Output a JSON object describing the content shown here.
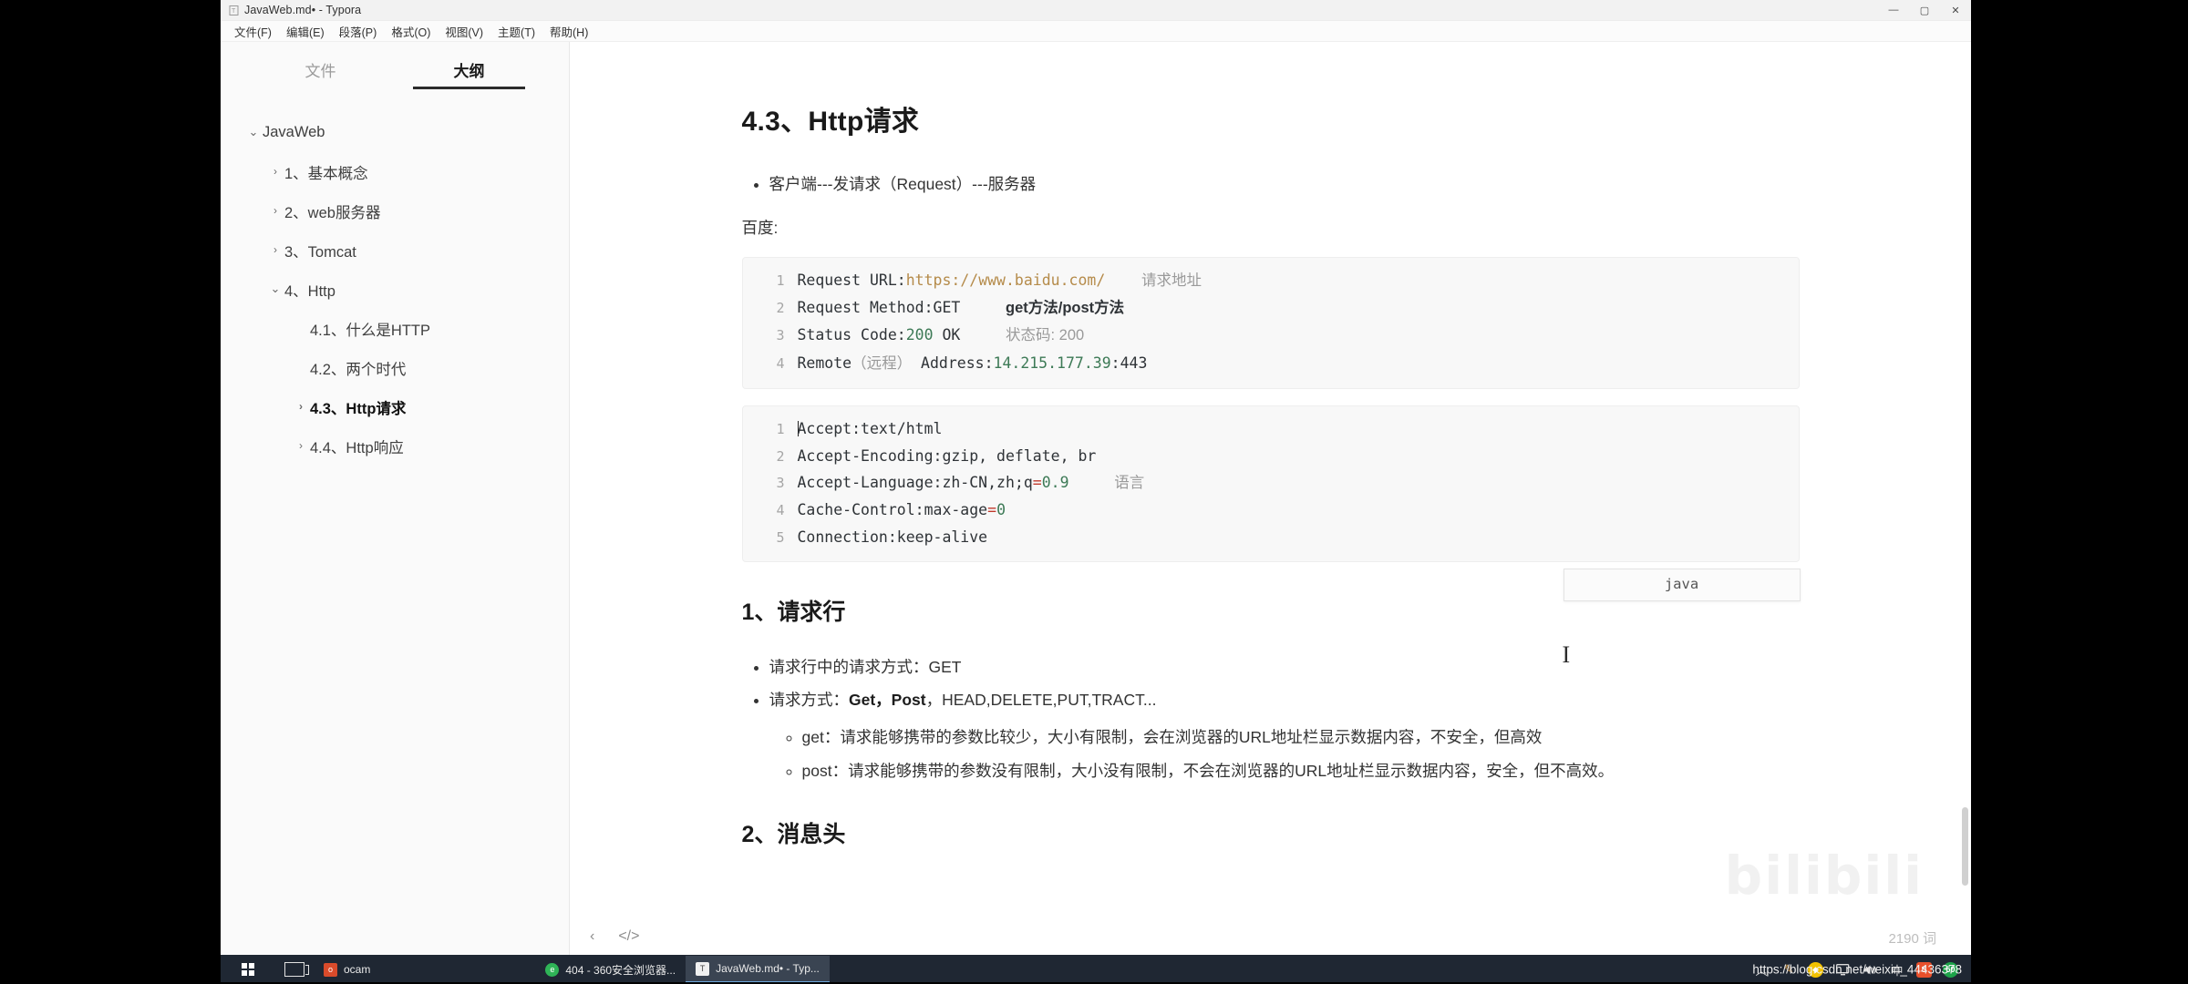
{
  "window": {
    "title": "JavaWeb.md• - Typora",
    "doc_icon": "document-icon",
    "controls": {
      "minimize": "—",
      "maximize": "▢",
      "close": "✕"
    }
  },
  "menubar": {
    "items": [
      "文件(F)",
      "编辑(E)",
      "段落(P)",
      "格式(O)",
      "视图(V)",
      "主题(T)",
      "帮助(H)"
    ]
  },
  "sidebar": {
    "tabs": [
      {
        "label": "文件",
        "active": false
      },
      {
        "label": "大纲",
        "active": true
      }
    ],
    "outline": [
      {
        "label": "JavaWeb",
        "level": 0,
        "caret": "down",
        "active": false
      },
      {
        "label": "1、基本概念",
        "level": 1,
        "caret": "right",
        "active": false
      },
      {
        "label": "2、web服务器",
        "level": 1,
        "caret": "right",
        "active": false
      },
      {
        "label": "3、Tomcat",
        "level": 1,
        "caret": "right",
        "active": false
      },
      {
        "label": "4、Http",
        "level": 1,
        "caret": "down",
        "active": false
      },
      {
        "label": "4.1、什么是HTTP",
        "level": 2,
        "caret": "none",
        "active": false
      },
      {
        "label": "4.2、两个时代",
        "level": 2,
        "caret": "none",
        "active": false
      },
      {
        "label": "4.3、Http请求",
        "level": 2,
        "caret": "right",
        "active": true
      },
      {
        "label": "4.4、Http响应",
        "level": 2,
        "caret": "right",
        "active": false
      }
    ]
  },
  "document": {
    "heading": "4.3、Http请求",
    "bullet_1": "客户端---发请求（Request）---服务器",
    "paragraph_baidu": "百度:",
    "code_block_1": {
      "lines": [
        {
          "n": "1",
          "segments": [
            {
              "t": "Request URL:",
              "c": "plain"
            },
            {
              "t": "https://www.baidu.com/",
              "c": "url"
            },
            {
              "t": "    ",
              "c": "plain"
            },
            {
              "t": "请求地址",
              "c": "comment-cn"
            }
          ]
        },
        {
          "n": "2",
          "segments": [
            {
              "t": "Request Method:GET",
              "c": "plain"
            },
            {
              "t": "     ",
              "c": "plain"
            },
            {
              "t": "get方法/post方法",
              "c": "comment-cn-bold"
            }
          ]
        },
        {
          "n": "3",
          "segments": [
            {
              "t": "Status Code:",
              "c": "plain"
            },
            {
              "t": "200",
              "c": "num"
            },
            {
              "t": " OK",
              "c": "plain"
            },
            {
              "t": "     ",
              "c": "plain"
            },
            {
              "t": "状态码: 200",
              "c": "comment-cn"
            }
          ]
        },
        {
          "n": "4",
          "segments": [
            {
              "t": "Remote",
              "c": "plain"
            },
            {
              "t": "（远程）",
              "c": "comment-cn"
            },
            {
              "t": " Address:",
              "c": "plain"
            },
            {
              "t": "14.215.177.39",
              "c": "num"
            },
            {
              "t": ":443",
              "c": "plain"
            }
          ]
        }
      ]
    },
    "code_block_2": {
      "language_label": "java",
      "lines": [
        {
          "n": "1",
          "segments": [
            {
              "t": "Accept:text/html",
              "c": "plain"
            }
          ]
        },
        {
          "n": "2",
          "segments": [
            {
              "t": "Accept-Encoding:gzip, deflate, br",
              "c": "plain"
            }
          ]
        },
        {
          "n": "3",
          "segments": [
            {
              "t": "Accept-Language:zh-CN,zh;q",
              "c": "plain"
            },
            {
              "t": "=",
              "c": "op"
            },
            {
              "t": "0.9",
              "c": "num"
            },
            {
              "t": "     ",
              "c": "plain"
            },
            {
              "t": "语言",
              "c": "comment-cn"
            }
          ]
        },
        {
          "n": "4",
          "segments": [
            {
              "t": "Cache-Control:max-age",
              "c": "plain"
            },
            {
              "t": "=",
              "c": "op"
            },
            {
              "t": "0",
              "c": "num"
            }
          ]
        },
        {
          "n": "5",
          "segments": [
            {
              "t": "Connection:keep-alive",
              "c": "plain"
            }
          ]
        }
      ]
    },
    "section_request_line": {
      "heading": "1、请求行",
      "bullets": [
        {
          "text": "请求行中的请求方式：GET"
        },
        {
          "prefix": "请求方式：",
          "bold": "Get，Post",
          "suffix": "，HEAD,DELETE,PUT,TRACT..."
        }
      ],
      "sub_bullets": [
        "get：请求能够携带的参数比较少，大小有限制，会在浏览器的URL地址栏显示数据内容，不安全，但高效",
        "post：请求能够携带的参数没有限制，大小没有限制，不会在浏览器的URL地址栏显示数据内容，安全，但不高效。"
      ]
    },
    "section_headers_heading": "2、消息头",
    "word_count": "2190 词",
    "watermark": "bilibili"
  },
  "editor_footer": {
    "back_icon": "chevron-left-icon",
    "source_icon": "source-code-icon"
  },
  "taskbar": {
    "start": "start-button",
    "taskview": "task-view-button",
    "apps": [
      {
        "label": "ocam",
        "icon": "ocam-icon",
        "active": false
      },
      {
        "label": "404 - 360安全浏览器...",
        "icon": "browser-360-icon",
        "active": false
      },
      {
        "label": "JavaWeb.md• - Typ...",
        "icon": "typora-icon",
        "active": true
      }
    ],
    "tray": [
      {
        "name": "show-hidden-icons",
        "glyph": "︿"
      },
      {
        "name": "pen-tool-icon",
        "glyph": "✎"
      },
      {
        "name": "shield-green-icon",
        "glyph": "●"
      },
      {
        "name": "display-icon",
        "glyph": "🖵"
      },
      {
        "name": "volume-icon",
        "glyph": "🔊"
      },
      {
        "name": "ime-chinese-icon",
        "glyph": "中"
      },
      {
        "name": "sogou-icon",
        "glyph": "S"
      },
      {
        "name": "security-score-icon",
        "glyph": "50"
      }
    ],
    "url_overlay": "https://blog.csdn.net/weixin_44436378"
  },
  "colors": {
    "accent": "#2b2b2b",
    "code_bg": "#f8f8f8",
    "url_token": "#b58b4a",
    "num_token": "#3d7a56",
    "taskbar": "#1f2733"
  }
}
